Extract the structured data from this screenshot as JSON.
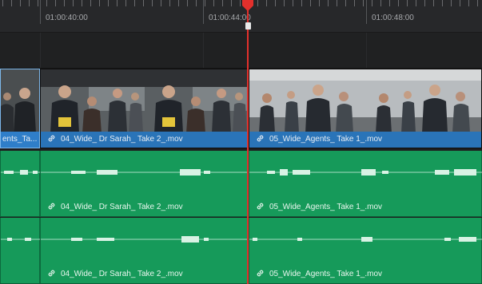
{
  "ruler": {
    "timecodes": [
      "01:00:40:00",
      "01:00:44:00",
      "01:00:48:00"
    ]
  },
  "video_clips": [
    {
      "name": "Agents_Ta...",
      "label": "ents_Ta..."
    },
    {
      "name": "04_Wide_ Dr Sarah_ Take 2_.mov",
      "label": "04_Wide_ Dr Sarah_ Take 2_.mov"
    },
    {
      "name": "05_Wide_Agents_ Take 1_.mov",
      "label": "05_Wide_Agents_ Take 1_.mov"
    }
  ],
  "audio_tracks": [
    {
      "clips": [
        {
          "label": ""
        },
        {
          "label": "04_Wide_ Dr Sarah_ Take 2_.mov"
        },
        {
          "label": "05_Wide_Agents_ Take 1_.mov"
        }
      ]
    },
    {
      "clips": [
        {
          "label": ""
        },
        {
          "label": "04_Wide_ Dr Sarah_ Take 2_.mov"
        },
        {
          "label": "05_Wide_Agents_ Take 1_.mov"
        }
      ]
    }
  ],
  "colors": {
    "video_clip": "#2a74b8",
    "audio_clip": "#169a5a",
    "playhead": "#e2302c"
  },
  "icons": [
    "link-icon",
    "playhead-icon"
  ]
}
